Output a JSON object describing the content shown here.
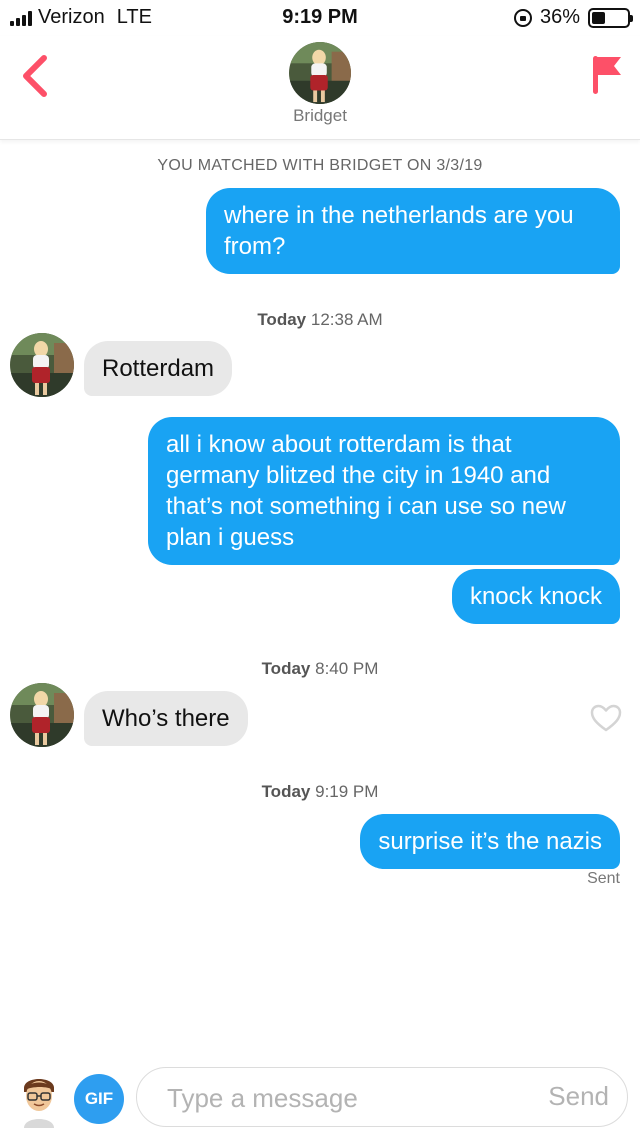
{
  "status_bar": {
    "carrier": "Verizon",
    "network": "LTE",
    "time": "9:19 PM",
    "battery": "36%",
    "icons": [
      "signal-icon",
      "orientation-lock-icon",
      "battery-icon"
    ]
  },
  "header": {
    "name": "Bridget",
    "back_icon": "chevron-left-icon",
    "report_icon": "flag-icon"
  },
  "chat": {
    "match_notice": "YOU MATCHED WITH BRIDGET ON 3/3/19",
    "messages": [
      {
        "from": "me",
        "text": "where in the netherlands are you from?"
      },
      {
        "timestamp_day": "Today",
        "timestamp_time": "12:38 AM"
      },
      {
        "from": "her",
        "text": "Rotterdam"
      },
      {
        "from": "me",
        "text": "all i know about rotterdam is that germany blitzed the city in 1940 and that’s not something i can use so new plan i guess"
      },
      {
        "from": "me",
        "text": "knock knock"
      },
      {
        "timestamp_day": "Today",
        "timestamp_time": "8:40 PM"
      },
      {
        "from": "her",
        "text": "Who’s there"
      },
      {
        "timestamp_day": "Today",
        "timestamp_time": "9:19 PM"
      },
      {
        "from": "me",
        "text": "surprise it’s the nazis"
      }
    ],
    "sent_status": "Sent"
  },
  "composer": {
    "gif_label": "GIF",
    "placeholder": "Type a message",
    "send_label": "Send"
  },
  "colors": {
    "outgoing_bubble": "#19a3f3",
    "incoming_bubble": "#e8e8e8",
    "accent_red": "#fd5068",
    "gif_button": "#2e9ef0"
  }
}
